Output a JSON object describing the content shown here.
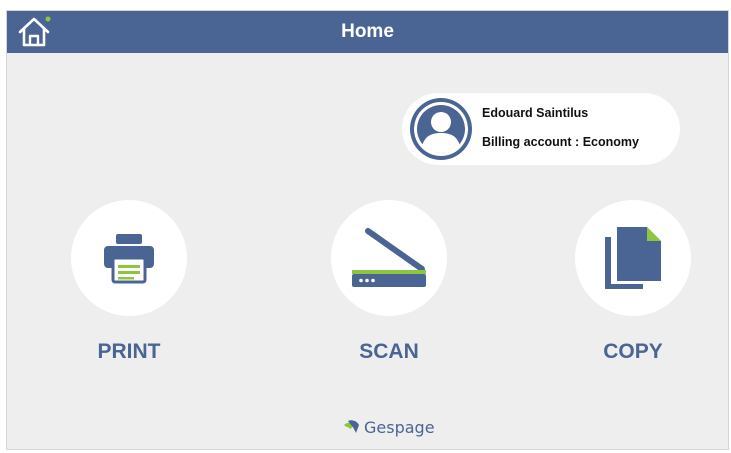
{
  "header": {
    "title": "Home",
    "home_icon": "home-icon"
  },
  "user": {
    "name": "Edouard Saintilus",
    "billing": "Billing account : Economy",
    "avatar_icon": "user-avatar-icon"
  },
  "actions": [
    {
      "label": "PRINT",
      "icon": "printer-icon"
    },
    {
      "label": "SCAN",
      "icon": "scanner-icon"
    },
    {
      "label": "COPY",
      "icon": "copy-icon"
    }
  ],
  "footer": {
    "brand": "Gespage"
  },
  "colors": {
    "header_bg": "#4a6494",
    "accent": "#4a6494",
    "accent_green": "#8cc63f",
    "background": "#eeeeee",
    "card_bg": "#ffffff"
  }
}
